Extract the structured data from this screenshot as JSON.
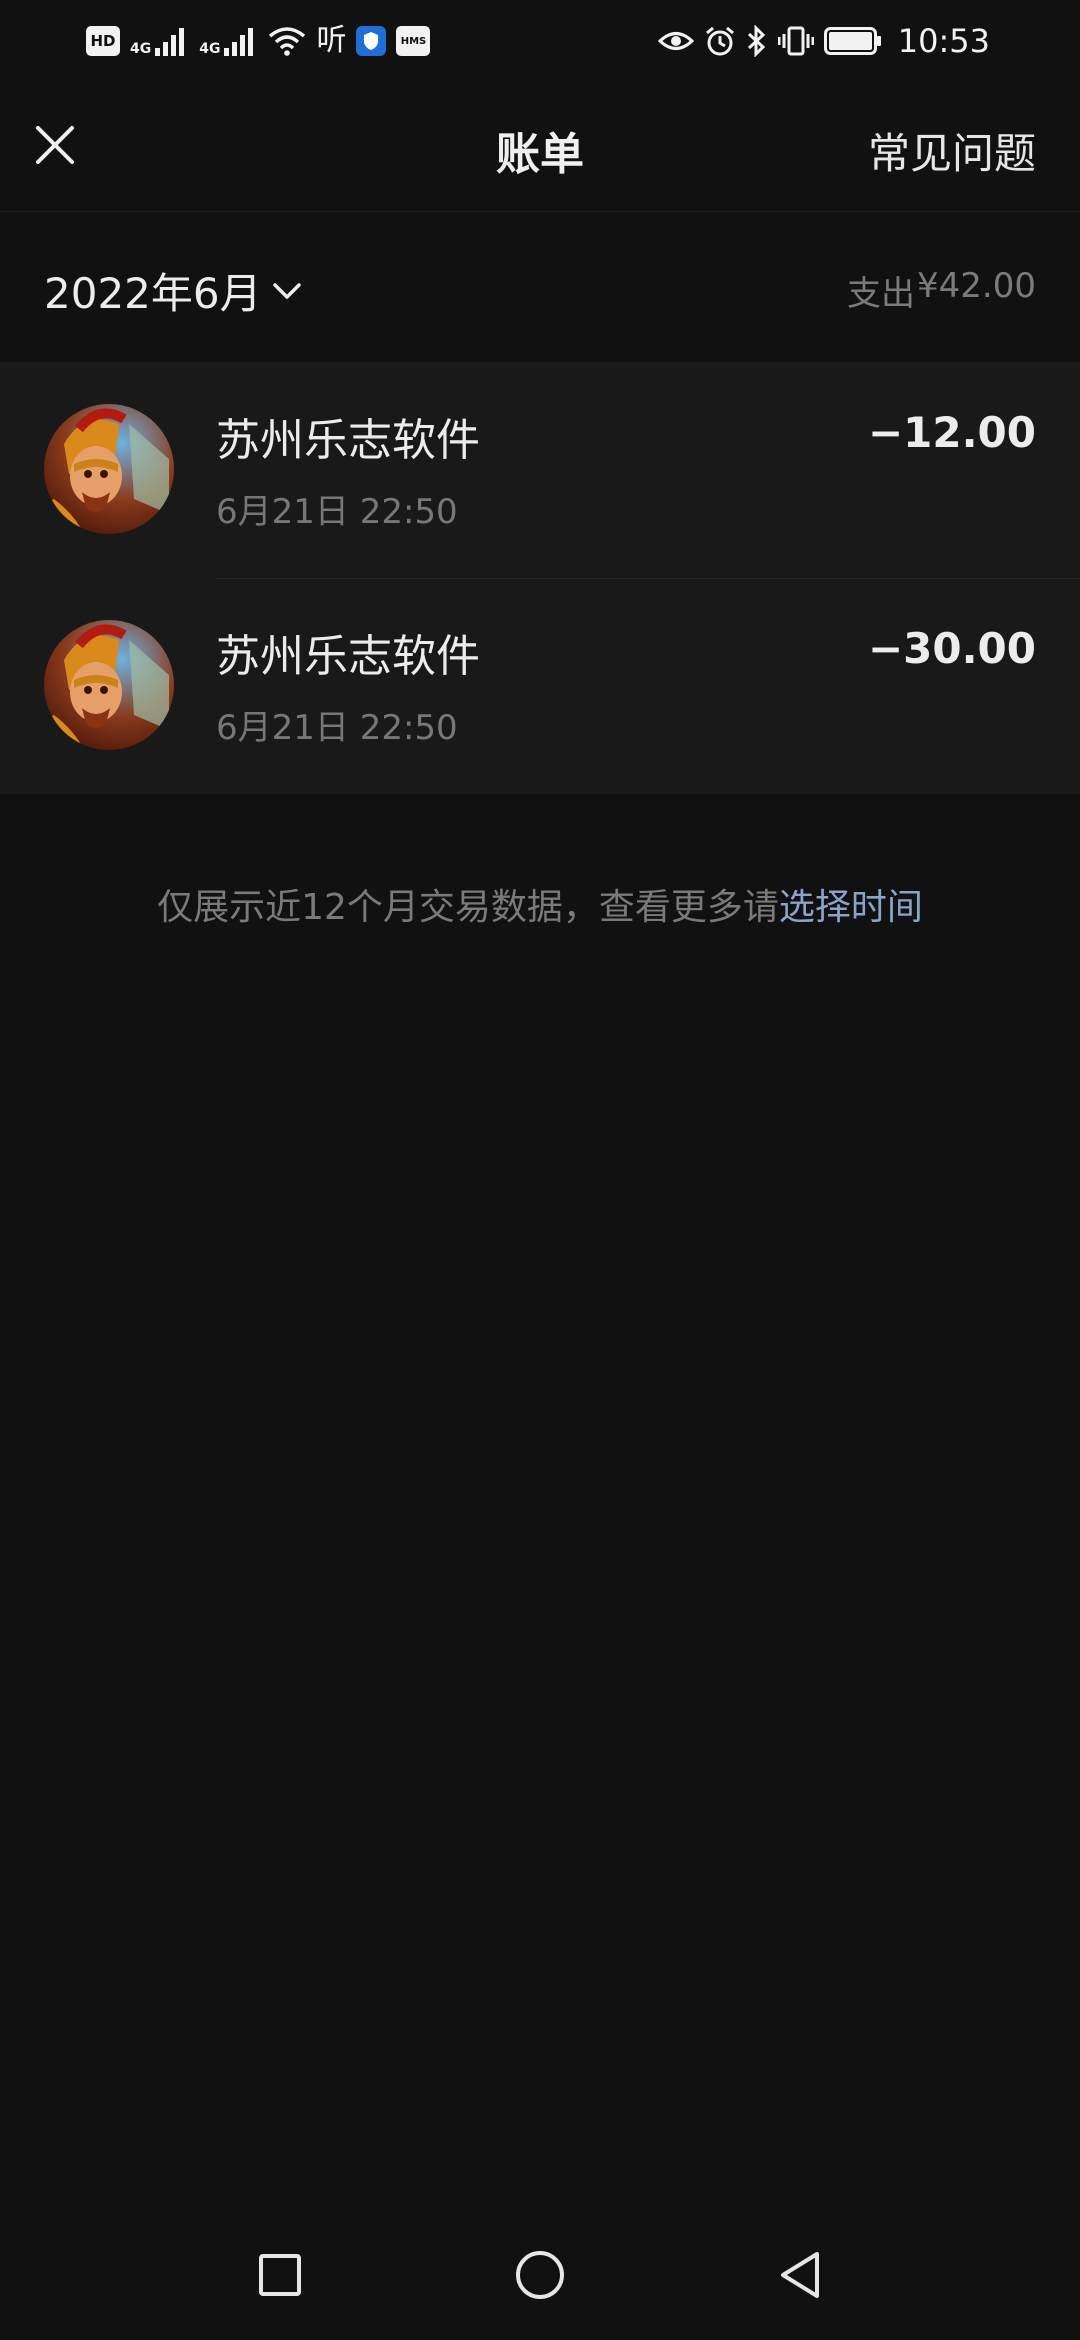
{
  "status_bar": {
    "hd_badge": "HD",
    "network_1": "4G",
    "network_2": "4G",
    "listen_text": "听",
    "hms_badge": "HMS",
    "time": "10:53"
  },
  "header": {
    "title": "账单",
    "faq_label": "常见问题",
    "close_icon": "close-icon"
  },
  "month_bar": {
    "month_label": "2022年6月",
    "spend_label": "支出",
    "spend_amount": "¥42.00"
  },
  "transactions": [
    {
      "merchant": "苏州乐志软件",
      "time": "6月21日 22:50",
      "amount": "−12.00"
    },
    {
      "merchant": "苏州乐志软件",
      "time": "6月21日 22:50",
      "amount": "−30.00"
    }
  ],
  "footer": {
    "note": "仅展示近12个月交易数据，查看更多请",
    "link": "选择时间"
  },
  "colors": {
    "background": "#111111",
    "row_background": "#191919",
    "link": "#8aa3c8"
  }
}
